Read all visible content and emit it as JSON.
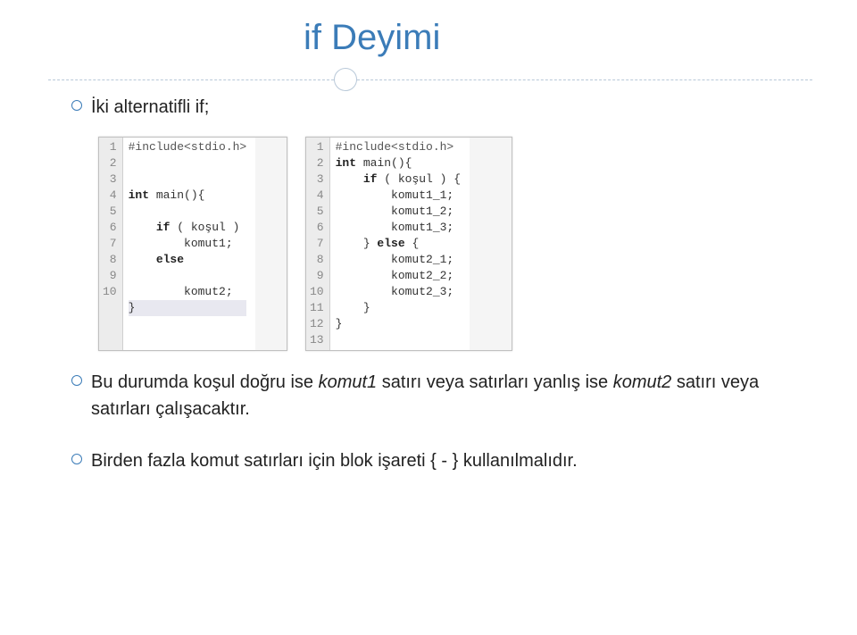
{
  "title": "if Deyimi",
  "bullet1": "İki alternatifli if;",
  "code1": {
    "lines": [
      "#include<stdio.h>",
      "",
      "",
      "int main(){",
      "",
      "    if ( koşul )",
      "        komut1;",
      "    else",
      "",
      "        komut2;",
      "}",
      ""
    ],
    "nums": [
      "1",
      "2",
      "3",
      "4",
      "5",
      "6",
      "7",
      "8",
      "9",
      "10",
      ""
    ]
  },
  "code2": {
    "lines": [
      "#include<stdio.h>",
      "int main(){",
      "    if ( koşul ) {",
      "        komut1_1;",
      "        komut1_2;",
      "        komut1_3;",
      "    } else {",
      "        komut2_1;",
      "        komut2_2;",
      "        komut2_3;",
      "    }",
      "}",
      ""
    ],
    "nums": [
      "1",
      "2",
      "3",
      "4",
      "5",
      "6",
      "7",
      "8",
      "9",
      "10",
      "11",
      "12",
      "13"
    ]
  },
  "para2_pre": "Bu durumda koşul doğru ise ",
  "para2_k1": "komut1",
  "para2_mid1": " satırı veya satırları yanlış ise ",
  "para2_k2": "komut2",
  "para2_mid2": " satırı veya satırları çalışacaktır.",
  "para3": "Birden fazla komut satırları için blok işareti { - } kullanılmalıdır."
}
